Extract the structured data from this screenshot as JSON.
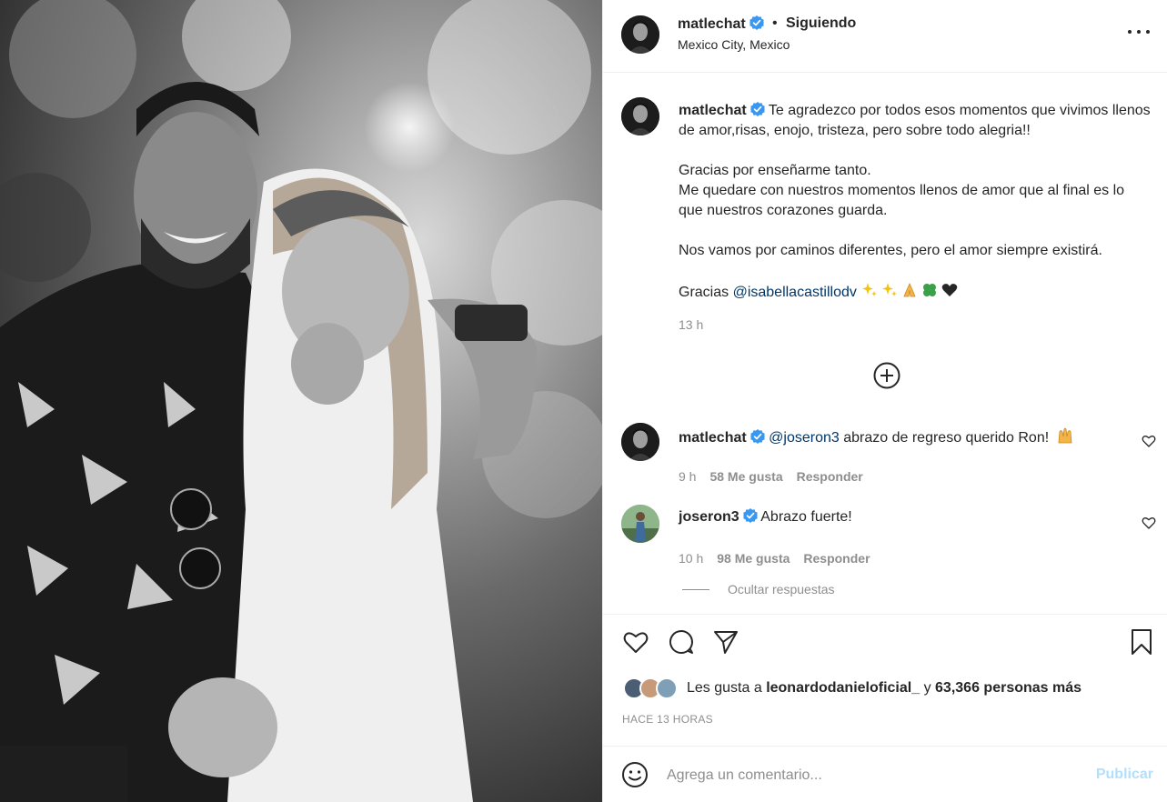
{
  "post": {
    "username": "matlechat",
    "separator": "•",
    "follow_status": "Siguiendo",
    "location": "Mexico City, Mexico",
    "photo_icon": "couple-bw-photo"
  },
  "caption": {
    "username": "matlechat",
    "line1": "Te agradezco por todos esos momentos que vivimos llenos de amor,risas, enojo, tristeza, pero sobre todo alegria!!",
    "line2": "Gracias por enseñarme tanto.",
    "line3": "Me quedare con nuestros momentos llenos de amor que al final es lo que nuestros corazones guarda.",
    "line4": "Nos vamos por caminos diferentes, pero el amor siempre existirá.",
    "thanks": "Gracias",
    "mention": "@isabellacastillodv",
    "emojis": [
      "sparkles",
      "sparkles",
      "folded-hands",
      "four-leaf-clover",
      "black-heart"
    ],
    "time": "13 h"
  },
  "comments": [
    {
      "username": "matlechat",
      "mention": "@joseron3",
      "text": "abrazo de regreso querido Ron!",
      "emoji": "raising-hands",
      "time": "9 h",
      "likes": "58 Me gusta",
      "reply": "Responder"
    },
    {
      "username": "joseron3",
      "text": "Abrazo fuerte!",
      "time": "10 h",
      "likes": "98 Me gusta",
      "reply": "Responder"
    }
  ],
  "hide_replies": "Ocultar respuestas",
  "likes_line": {
    "prefix": "Les gusta a",
    "user": "leonardodanieloficial_",
    "middle": "y",
    "count": "63,366 personas más"
  },
  "posted_ago": "HACE 13 HORAS",
  "comment_box": {
    "placeholder": "Agrega un comentario...",
    "publish_label": "Publicar"
  },
  "colors": {
    "verified": "#3897f0",
    "link": "#00376b",
    "muted": "#8e8e8e",
    "publish_disabled": "#b2dffc"
  }
}
